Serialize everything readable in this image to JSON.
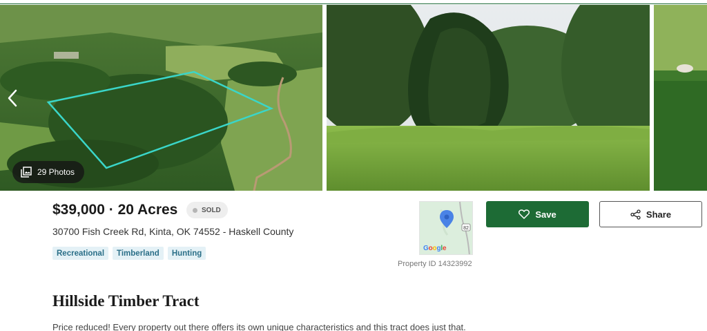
{
  "gallery": {
    "photo_count_label": "29 Photos",
    "photos": [
      "aerial-photo",
      "tree-photo",
      "aerial-photo-partial"
    ],
    "prev_icon": "chevron-left-icon",
    "count_icon": "photo-gallery-icon"
  },
  "listing": {
    "price_acres": "$39,000 · 20 Acres",
    "status": "SOLD",
    "address": "30700 Fish Creek Rd, Kinta, OK 74552 - Haskell County",
    "tags": [
      "Recreational",
      "Timberland",
      "Hunting"
    ],
    "property_id": "Property ID 14323992",
    "title": "Hillside Timber Tract",
    "description": "Price reduced! Every property out there offers its own unique characteristics and this tract does just that."
  },
  "map": {
    "route_label": "82",
    "google_letters": [
      "G",
      "o",
      "o",
      "g",
      "l",
      "e"
    ],
    "google_colors": [
      "#4285F4",
      "#EA4335",
      "#FBBC05",
      "#4285F4",
      "#34A853",
      "#EA4335"
    ]
  },
  "actions": {
    "save_label": "Save",
    "share_label": "Share",
    "save_icon": "heart-icon",
    "share_icon": "share-icon"
  },
  "colors": {
    "brand_green": "#1d6b35",
    "tag_bg": "#e4f1f6",
    "tag_text": "#2b6f88",
    "boundary": "#3ad6c9"
  }
}
